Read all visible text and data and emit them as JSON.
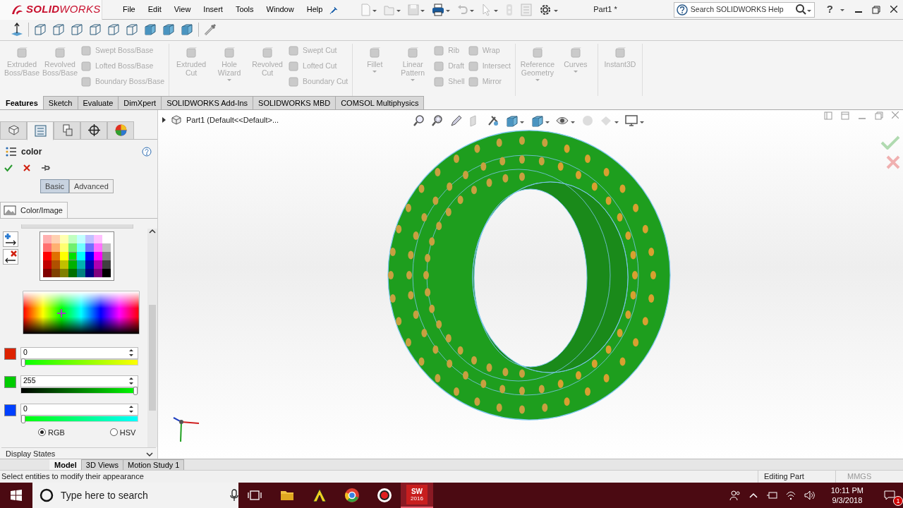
{
  "title_bar": {
    "logo": "**SOLID**WORKS",
    "menu": [
      "File",
      "Edit",
      "View",
      "Insert",
      "Tools",
      "Window",
      "Help"
    ],
    "document_title": "Part1 *",
    "search": {
      "placeholder": "Search SOLIDWORKS Help"
    },
    "help": "?"
  },
  "ribbon": {
    "disabled": true,
    "groups": [
      {
        "items": [
          {
            "kind": "large",
            "label": "Extruded Boss/Base"
          },
          {
            "kind": "large",
            "label": "Revolved Boss/Base"
          },
          {
            "kind": "stack",
            "labels": [
              "Swept Boss/Base",
              "Lofted Boss/Base",
              "Boundary Boss/Base"
            ]
          }
        ]
      },
      {
        "items": [
          {
            "kind": "large",
            "label": "Extruded Cut"
          },
          {
            "kind": "large",
            "label": "Hole Wizard",
            "dropdown": true
          },
          {
            "kind": "large",
            "label": "Revolved Cut"
          },
          {
            "kind": "stack",
            "labels": [
              "Swept Cut",
              "Lofted Cut",
              "Boundary Cut"
            ]
          }
        ]
      },
      {
        "items": [
          {
            "kind": "large",
            "label": "Fillet",
            "dropdown": true
          },
          {
            "kind": "large",
            "label": "Linear Pattern",
            "dropdown": true
          },
          {
            "kind": "stack",
            "labels": [
              "Rib",
              "Draft",
              "Shell"
            ]
          },
          {
            "kind": "stack",
            "labels": [
              "Wrap",
              "Intersect",
              "Mirror"
            ]
          }
        ]
      },
      {
        "items": [
          {
            "kind": "large",
            "label": "Reference Geometry",
            "dropdown": true
          },
          {
            "kind": "large",
            "label": "Curves",
            "dropdown": true
          }
        ]
      },
      {
        "items": [
          {
            "kind": "large",
            "label": "Instant3D"
          }
        ]
      }
    ]
  },
  "command_tabs": [
    {
      "label": "Features",
      "selected": true
    },
    {
      "label": "Sketch",
      "selected": false
    },
    {
      "label": "Evaluate",
      "selected": false
    },
    {
      "label": "DimXpert",
      "selected": false
    },
    {
      "label": "SOLIDWORKS Add-Ins",
      "selected": false
    },
    {
      "label": "SOLIDWORKS MBD",
      "selected": false
    },
    {
      "label": "COMSOL Multiphysics",
      "selected": false
    }
  ],
  "property_manager": {
    "tabs": [
      {
        "kind": "feature-tree",
        "selected": false
      },
      {
        "kind": "property-manager",
        "selected": true
      },
      {
        "kind": "configuration",
        "selected": false
      },
      {
        "kind": "dimxpert",
        "selected": false
      },
      {
        "kind": "display-manager",
        "selected": false
      }
    ],
    "title": "color",
    "modes": [
      {
        "label": "Basic",
        "selected": true
      },
      {
        "label": "Advanced",
        "selected": false
      }
    ],
    "section": "Color/Image",
    "channels": [
      {
        "value": "0",
        "level": 0,
        "color": "#dd2200"
      },
      {
        "value": "255",
        "level": 1,
        "color": "#00cc00"
      },
      {
        "value": "0",
        "level": 0,
        "color": "#0040ff"
      }
    ],
    "color_models": [
      {
        "label": "RGB",
        "selected": true
      },
      {
        "label": "HSV",
        "selected": false
      }
    ],
    "display_states": "Display States"
  },
  "feature_tree": {
    "label": "Part1  (Default<<Default>...",
    "expanded": false
  },
  "bottom_tabs": [
    {
      "label": "Model",
      "selected": true
    },
    {
      "label": "3D Views",
      "selected": false
    },
    {
      "label": "Motion Study 1",
      "selected": false
    }
  ],
  "status_bar": {
    "message": "Select entities to modify their appearance",
    "mode": "Editing Part",
    "units": "MMGS"
  },
  "taskbar": {
    "search": {
      "placeholder": "Type here to search"
    },
    "apps": [
      {
        "kind": "folder",
        "selected": false
      },
      {
        "kind": "autodesk",
        "selected": false
      },
      {
        "kind": "browser",
        "selected": false
      },
      {
        "kind": "recorder",
        "selected": false
      },
      {
        "kind": "solidworks",
        "selected": true,
        "label": "SW",
        "sublabel": "2016"
      }
    ],
    "time": "10:11 PM",
    "date": "9/3/2018",
    "notifications": "1"
  }
}
